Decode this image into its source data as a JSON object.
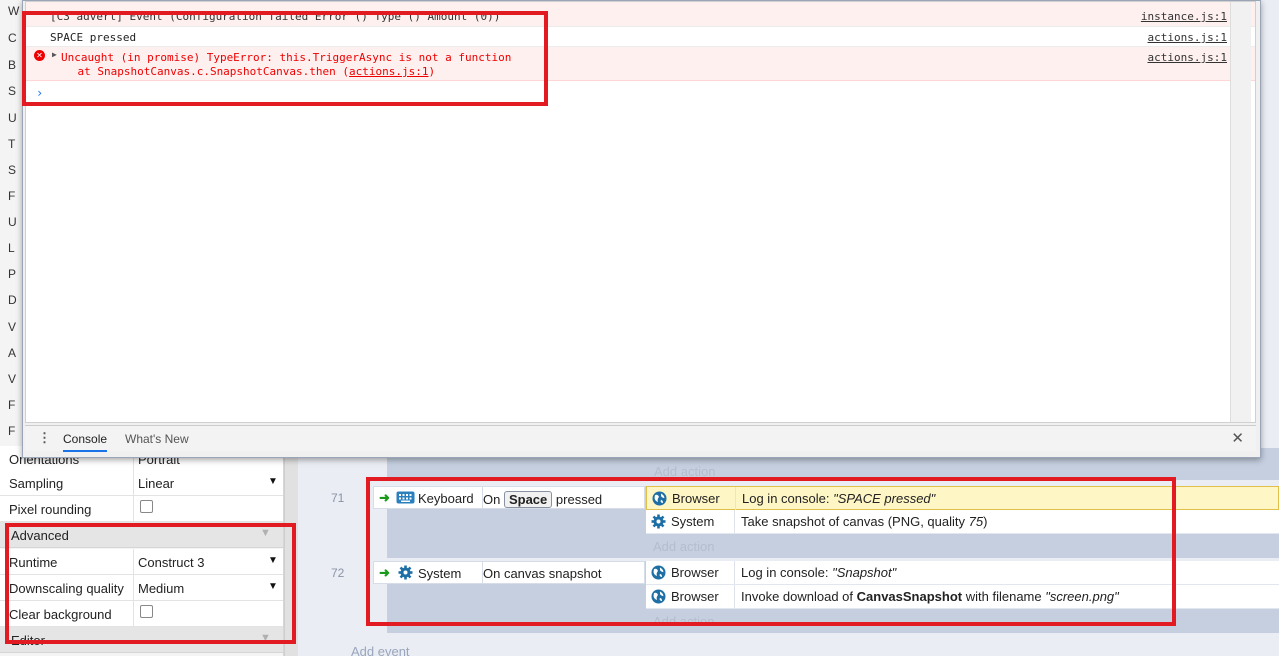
{
  "left_panel": {
    "fragments": [
      "W",
      "C",
      "B",
      "S",
      "U",
      "T",
      "S",
      "F",
      "U",
      "L",
      "P",
      "D",
      "V",
      "A",
      "V",
      "F",
      "F"
    ],
    "rows_top": [
      {
        "name": "Orientations",
        "value": "Portrait"
      },
      {
        "name": "Sampling",
        "value": "Linear",
        "type": "select"
      },
      {
        "name": "Pixel rounding",
        "type": "checkbox"
      }
    ],
    "advanced_header": "Advanced",
    "rows_advanced": [
      {
        "name": "Runtime",
        "value": "Construct 3",
        "type": "select"
      },
      {
        "name": "Downscaling quality",
        "value": "Medium",
        "type": "select"
      },
      {
        "name": "Clear background",
        "type": "checkbox"
      }
    ],
    "editor_header": "Editor",
    "select_caret": "▼",
    "header_caret": "▼"
  },
  "devtools": {
    "console_lines": [
      {
        "text": "[C3 advert] Event (Configuration failed Error () Type () Amount (0))",
        "source": "instance.js:1"
      },
      {
        "text": "SPACE pressed",
        "source": "actions.js:1"
      }
    ],
    "error": {
      "line1": "Uncaught (in promise) TypeError: this.TriggerAsync is not a function",
      "line2_prefix": "    at SnapshotCanvas.c.SnapshotCanvas.then (",
      "line2_link": "actions.js:1",
      "line2_suffix": ")",
      "source": "actions.js:1"
    },
    "prompt": "›",
    "tabs": [
      "Console",
      "What's New"
    ],
    "close": "✕",
    "dots": "⋮"
  },
  "events": {
    "add_action": "Add action",
    "add_event": "Add event",
    "ev71": {
      "number": "71",
      "condition": {
        "object": "Keyboard",
        "text_pre": "On",
        "key": "Space",
        "text_post": "pressed"
      },
      "actions": [
        {
          "object": "Browser",
          "text_pre": "Log in console: ",
          "italic": "\"SPACE pressed\"",
          "icon": "globe-icon"
        },
        {
          "object": "System",
          "text_pre": "Take snapshot of canvas (PNG, quality ",
          "italic": "75",
          "text_post": ")",
          "icon": "gear-icon"
        }
      ]
    },
    "ev72": {
      "number": "72",
      "condition": {
        "object": "System",
        "text": "On canvas snapshot"
      },
      "actions": [
        {
          "object": "Browser",
          "text_pre": "Log in console: ",
          "italic": "\"Snapshot\"",
          "icon": "globe-icon"
        },
        {
          "object": "Browser",
          "text_pre": "Invoke download of ",
          "bold": "CanvasSnapshot",
          "text_mid": " with filename ",
          "italic": "\"screen.png\"",
          "icon": "globe-icon"
        }
      ]
    }
  },
  "colors": {
    "annotation": "#e21b23",
    "highlight": "#fff6c5",
    "event_block": "#c5cfe0",
    "error_text": "#e00000"
  }
}
